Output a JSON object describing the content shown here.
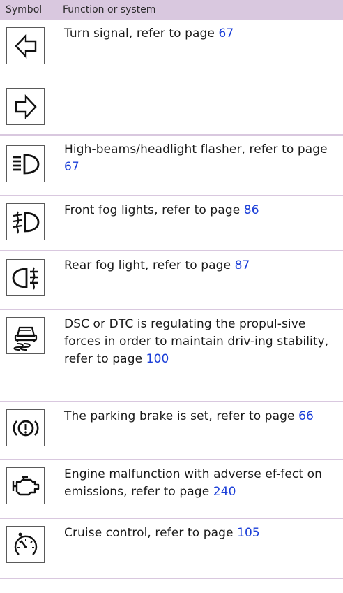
{
  "header": {
    "symbol": "Symbol",
    "function": "Function or system"
  },
  "rows": [
    {
      "prefix": "Turn signal, refer to page ",
      "page": "67",
      "icons": [
        "arrow-left-icon",
        "arrow-right-icon"
      ]
    },
    {
      "prefix": "High-beams/headlight flasher, refer to page ",
      "page": "67",
      "icons": [
        "high-beam-icon"
      ]
    },
    {
      "prefix": "Front fog lights, refer to page ",
      "page": "86",
      "icons": [
        "front-fog-light-icon"
      ]
    },
    {
      "prefix": "Rear fog light, refer to page ",
      "page": "87",
      "icons": [
        "rear-fog-light-icon"
      ]
    },
    {
      "prefix": "DSC or DTC is regulating the propul-sive forces in order to maintain driv-ing stability, refer to page ",
      "page": "100",
      "icons": [
        "skidding-car-icon"
      ]
    },
    {
      "prefix": "The parking brake is set, refer to page ",
      "page": "66",
      "icons": [
        "parking-brake-icon"
      ]
    },
    {
      "prefix": "Engine malfunction with adverse ef-fect on emissions, refer to page ",
      "page": "240",
      "icons": [
        "engine-icon"
      ]
    },
    {
      "prefix": "Cruise control, refer to page ",
      "page": "105",
      "icons": [
        "cruise-control-icon"
      ]
    }
  ],
  "colors": {
    "header_bg": "#d9c8df",
    "link": "#1a3ed8",
    "rule": "#d9c8df"
  }
}
